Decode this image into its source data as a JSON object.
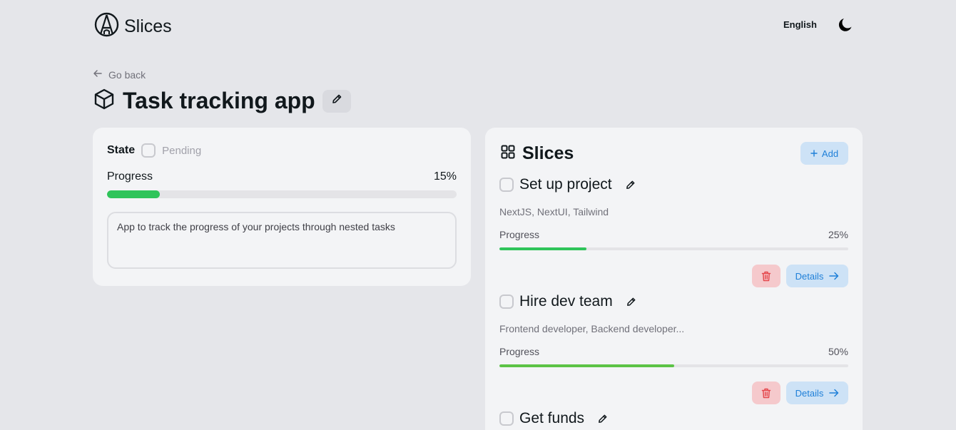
{
  "app": {
    "name": "Slices",
    "language": "English",
    "logo_icon": "pencil-circle-logo-icon",
    "theme_icon": "moon-icon"
  },
  "nav": {
    "go_back": "Go back"
  },
  "project": {
    "title": "Task tracking app",
    "state_label": "State",
    "state_value": "Pending",
    "progress_label": "Progress",
    "progress_text": "15%",
    "progress": 0.15,
    "description": "App to track the progress of your projects through nested tasks"
  },
  "slices": {
    "title": "Slices",
    "add_label": "Add",
    "items": [
      {
        "name": "Set up project",
        "tags": "NextJS, NextUI, Tailwind",
        "progress_label": "Progress",
        "progress_text": "25%",
        "progress": 0.25,
        "details_label": "Details"
      },
      {
        "name": "Hire dev team",
        "tags": "Frontend developer, Backend developer...",
        "progress_label": "Progress",
        "progress_text": "50%",
        "progress": 0.5,
        "details_label": "Details"
      },
      {
        "name": "Get funds"
      }
    ]
  },
  "colors": {
    "accent": "#1e7fd8",
    "progress": "#2fc45a",
    "danger": "#e5484d",
    "background": "#e5e6ea",
    "card": "#f3f4f6"
  }
}
